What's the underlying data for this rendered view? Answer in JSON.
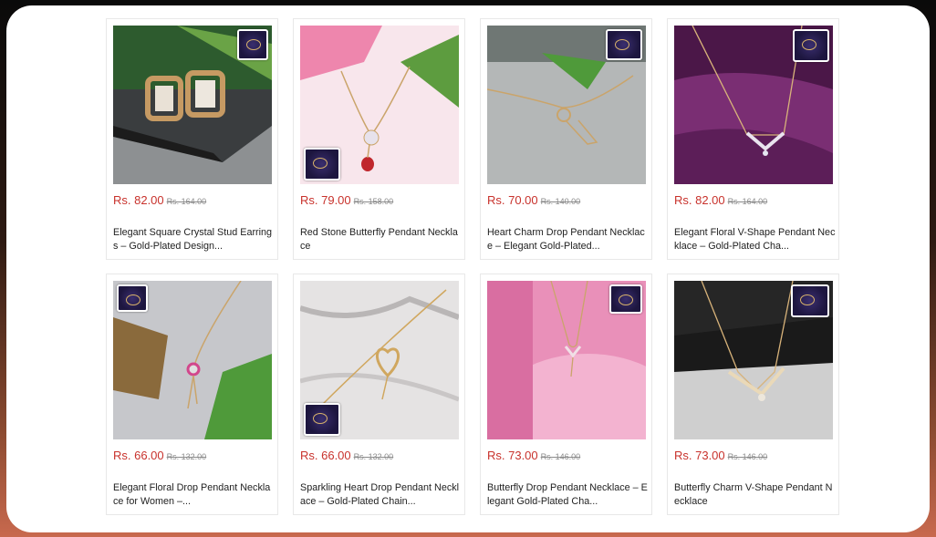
{
  "products": [
    {
      "price": "Rs. 82.00",
      "old_price": "Rs. 164.00",
      "title": "Elegant Square Crystal Stud Earrings – Gold-Plated Design...",
      "bg": "#6b6f72",
      "thumb": "tr"
    },
    {
      "price": "Rs. 79.00",
      "old_price": "Rs. 158.00",
      "title": "Red Stone Butterfly Pendant Necklace",
      "bg": "#f6d9e3",
      "thumb": "bl"
    },
    {
      "price": "Rs. 70.00",
      "old_price": "Rs. 140.00",
      "title": "Heart Charm Drop Pendant Necklace – Elegant Gold-Plated...",
      "bg": "#b9bcbc",
      "thumb": "tr"
    },
    {
      "price": "Rs. 82.00",
      "old_price": "Rs. 164.00",
      "title": "Elegant Floral V-Shape Pendant Necklace – Gold-Plated Cha...",
      "bg": "#5a1f58",
      "thumb": "tr"
    },
    {
      "price": "Rs. 66.00",
      "old_price": "Rs. 132.00",
      "title": "Elegant Floral Drop Pendant Necklace for Women –...",
      "bg": "#c9c9cc",
      "thumb": "tl"
    },
    {
      "price": "Rs. 66.00",
      "old_price": "Rs. 132.00",
      "title": "Sparkling Heart Drop Pendant Necklace – Gold-Plated Chain...",
      "bg": "#e4e2e2",
      "thumb": "bl"
    },
    {
      "price": "Rs. 73.00",
      "old_price": "Rs. 146.00",
      "title": "Butterfly Drop Pendant Necklace – Elegant Gold-Plated Cha...",
      "bg": "#ef9fc3",
      "thumb": "tr"
    },
    {
      "price": "Rs. 73.00",
      "old_price": "Rs. 146.00",
      "title": "Butterfly Charm V-Shape Pendant Necklace",
      "bg": "#2b2b2b",
      "thumb": "tr"
    }
  ]
}
